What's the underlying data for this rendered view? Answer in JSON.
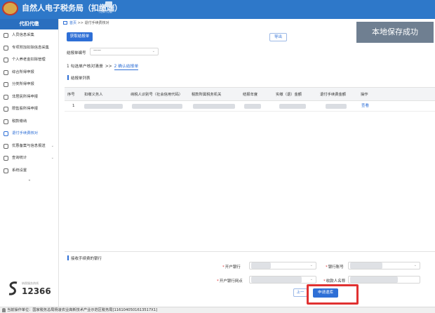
{
  "header": {
    "app_title": "自然人电子税务局（扣缴端）",
    "tab_label": "代扣代缴"
  },
  "sidebar": {
    "title": "代扣代缴",
    "items": [
      {
        "label": "人员信息采集",
        "icon": "user-icon"
      },
      {
        "label": "专项附加扣除信息采集",
        "icon": "list-icon"
      },
      {
        "label": "个人养老金扣除管理",
        "icon": "person-card-icon"
      },
      {
        "label": "综合所得申报",
        "icon": "gear-icon"
      },
      {
        "label": "分类所得申报",
        "icon": "gear-icon"
      },
      {
        "label": "非居民所得申报",
        "icon": "person-icon"
      },
      {
        "label": "限售股所得申报",
        "icon": "chart-icon"
      },
      {
        "label": "税款缴纳",
        "icon": "document-icon"
      },
      {
        "label": "退付手续费核对",
        "icon": "edit-icon",
        "active": true
      },
      {
        "label": "优惠备案与信息报送",
        "icon": "document-icon",
        "has_children": true
      },
      {
        "label": "查询统计",
        "icon": "search-icon",
        "has_children": true
      },
      {
        "label": "系统设置",
        "icon": "settings-icon"
      }
    ],
    "brand_sub": "纳税服务热线",
    "brand_number": "12366"
  },
  "breadcrumb": {
    "home": "首页",
    "separator": ">>",
    "current": "退付手续费核对"
  },
  "toast": {
    "text": "本地保存成功"
  },
  "toolbar": {
    "fetch_label": "获取结报单",
    "export_label": "导出"
  },
  "filter": {
    "label": "结报单编号",
    "value": "一一"
  },
  "steps": {
    "step1": "1 勾选单户核对清册",
    "separator": ">>",
    "step2": "2 确认结报单"
  },
  "list_section": {
    "title": "结报单列表"
  },
  "table": {
    "columns": [
      "序号",
      "扣缴义务人",
      "纳税人识别号（社会信用代码）",
      "税款所属税务机关",
      "结报年度",
      "实缴（退）金额",
      "退付手续费金额",
      "操作"
    ],
    "rows": [
      {
        "index": "1",
        "action": "查看"
      }
    ]
  },
  "bank_section": {
    "title": "接收手续费的银行",
    "bank_label": "开户银行",
    "account_label": "银行账号",
    "branch_label": "开户银行网点",
    "payee_label": "收款人名称",
    "required_mark": "*"
  },
  "actions": {
    "prev_label": "上一",
    "submit_label": "申请退库"
  },
  "statusbar": {
    "text": "当前操作单位：国家税务总局杨凌农业高新技术产业示范区税务局[1161040501613517X1]"
  },
  "colors": {
    "accent": "#2e6fd6",
    "header": "#2e78c9",
    "highlight": "#e03131"
  }
}
